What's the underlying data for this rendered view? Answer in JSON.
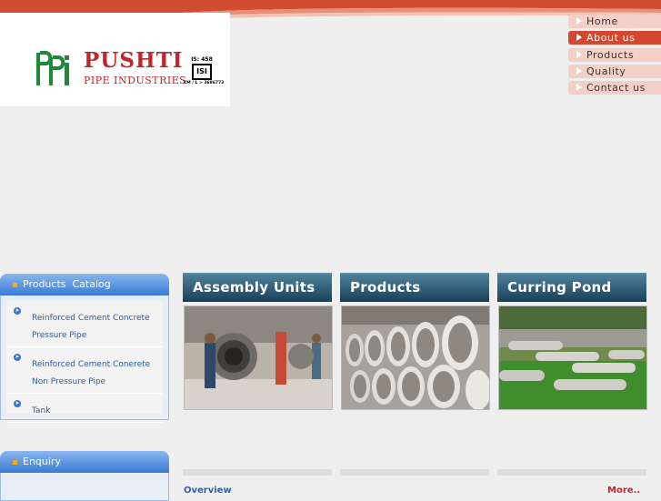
{
  "brand": {
    "name": "PUSHTI",
    "subtitle": "PIPE INDUSTRIES",
    "mark": "ppi",
    "cert_top": "IS: 458",
    "cert_mark": "ISI",
    "cert_bottom": "CM / L > 3686773"
  },
  "nav": {
    "items": [
      {
        "label": "Home",
        "active": false
      },
      {
        "label": "About us",
        "active": true
      },
      {
        "label": "Products",
        "active": false
      },
      {
        "label": "Quality",
        "active": false
      },
      {
        "label": "Contact us",
        "active": false
      }
    ]
  },
  "catalog": {
    "title": "Products  Catalog",
    "items": [
      {
        "label": "Reinforced Cement Concrete Pressure Pipe"
      },
      {
        "label": "Reinforced Cement Conerete Non Pressure Pipe"
      },
      {
        "label": "Tank"
      }
    ]
  },
  "enquiry": {
    "title": "Enquiry"
  },
  "sections": [
    {
      "title": "Assembly Units",
      "image": "factory-workers-photo"
    },
    {
      "title": "Products",
      "image": "concrete-pipes-photo"
    },
    {
      "title": "Curring Pond",
      "image": "curing-pond-photo"
    }
  ],
  "links": {
    "overview": "Overview",
    "more": "More.."
  },
  "colors": {
    "accent_red": "#d3472e",
    "brand_red": "#c0262c",
    "nav_inactive": "#f4cfc6",
    "panel_blue": "#3a7bd5",
    "section_header": "#183f59"
  }
}
